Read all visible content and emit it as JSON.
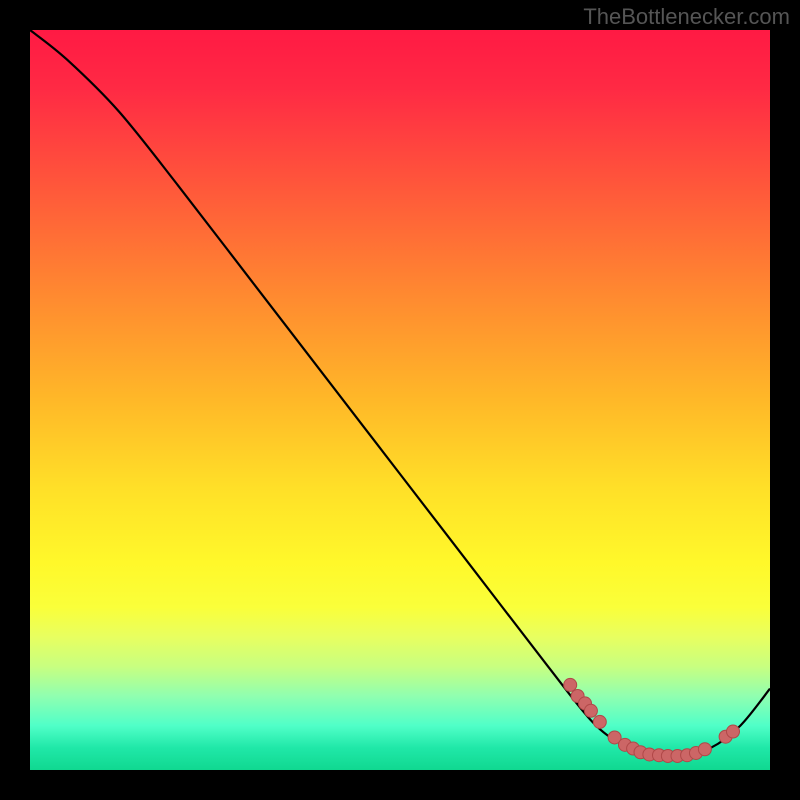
{
  "watermark": "TheBottlenecker.com",
  "chart_data": {
    "type": "line",
    "title": "",
    "xlabel": "",
    "ylabel": "",
    "xlim": [
      0,
      1
    ],
    "ylim": [
      0,
      1
    ],
    "series": [
      {
        "name": "curve",
        "points": [
          {
            "x": 0.0,
            "y": 1.0
          },
          {
            "x": 0.05,
            "y": 0.96
          },
          {
            "x": 0.12,
            "y": 0.89
          },
          {
            "x": 0.2,
            "y": 0.79
          },
          {
            "x": 0.3,
            "y": 0.66
          },
          {
            "x": 0.4,
            "y": 0.53
          },
          {
            "x": 0.5,
            "y": 0.4
          },
          {
            "x": 0.6,
            "y": 0.27
          },
          {
            "x": 0.7,
            "y": 0.14
          },
          {
            "x": 0.76,
            "y": 0.065
          },
          {
            "x": 0.8,
            "y": 0.035
          },
          {
            "x": 0.84,
            "y": 0.02
          },
          {
            "x": 0.88,
            "y": 0.02
          },
          {
            "x": 0.92,
            "y": 0.03
          },
          {
            "x": 0.96,
            "y": 0.06
          },
          {
            "x": 1.0,
            "y": 0.11
          }
        ]
      }
    ],
    "highlight_points": [
      {
        "x": 0.73,
        "y": 0.115
      },
      {
        "x": 0.74,
        "y": 0.1
      },
      {
        "x": 0.75,
        "y": 0.09
      },
      {
        "x": 0.758,
        "y": 0.08
      },
      {
        "x": 0.77,
        "y": 0.065
      },
      {
        "x": 0.79,
        "y": 0.044
      },
      {
        "x": 0.804,
        "y": 0.034
      },
      {
        "x": 0.815,
        "y": 0.029
      },
      {
        "x": 0.825,
        "y": 0.024
      },
      {
        "x": 0.837,
        "y": 0.021
      },
      {
        "x": 0.85,
        "y": 0.02
      },
      {
        "x": 0.862,
        "y": 0.019
      },
      {
        "x": 0.875,
        "y": 0.019
      },
      {
        "x": 0.888,
        "y": 0.02
      },
      {
        "x": 0.9,
        "y": 0.023
      },
      {
        "x": 0.912,
        "y": 0.028
      },
      {
        "x": 0.94,
        "y": 0.045
      },
      {
        "x": 0.95,
        "y": 0.052
      }
    ]
  },
  "colors": {
    "curve": "#000000",
    "marker_fill": "#cc6666",
    "marker_stroke": "#b04848"
  }
}
